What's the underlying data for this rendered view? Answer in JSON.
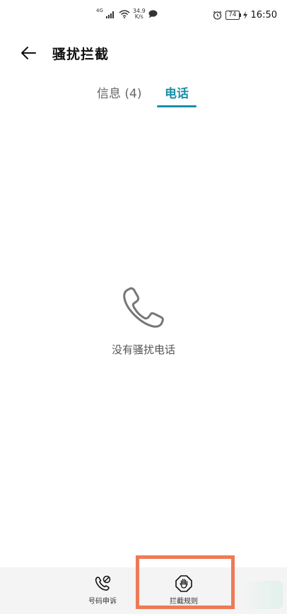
{
  "status_bar": {
    "network_tag": "4G",
    "speed_value": "34.9",
    "speed_unit": "K/s",
    "battery": "74",
    "time": "16:50"
  },
  "header": {
    "title": "骚扰拦截"
  },
  "tabs": [
    {
      "label": "信息 (4)",
      "active": false
    },
    {
      "label": "电话",
      "active": true
    }
  ],
  "empty_state": {
    "text": "没有骚扰电话"
  },
  "bottom_bar": {
    "items": [
      {
        "label": "号码申诉",
        "icon": "phone-report-icon"
      },
      {
        "label": "拦截规则",
        "icon": "block-hand-icon"
      }
    ]
  },
  "colors": {
    "accent": "#1a8fa6",
    "highlight": "#ee7a55"
  }
}
